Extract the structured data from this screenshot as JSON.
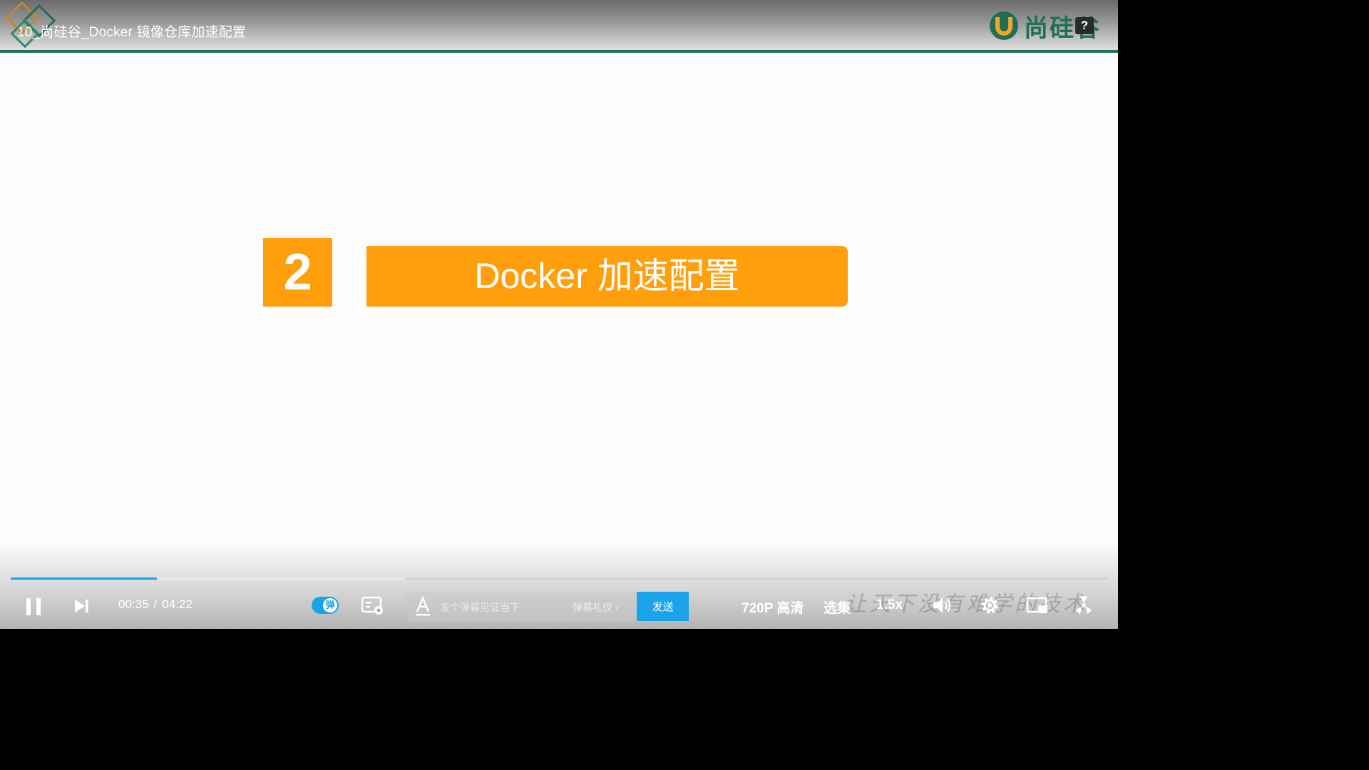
{
  "video": {
    "title": "10_尚硅谷_Docker 镜像仓库加速配置"
  },
  "brand": {
    "name": "尚硅谷",
    "help_label": "?",
    "icons": {
      "deco": "diamond-deco-icon",
      "logo": "brand-logo-icon"
    }
  },
  "slide": {
    "number": "2",
    "heading": "Docker 加速配置"
  },
  "playback": {
    "current_time": "00:35",
    "separator": "/",
    "duration": "04:22",
    "played_fraction": 0.133,
    "buffered_fraction": 0.36
  },
  "danmaku": {
    "toggle_label": "弹",
    "enabled": true,
    "input_placeholder": "发个弹幕见证当下",
    "etiquette_label": "弹幕礼仪 ›",
    "send_label": "发送"
  },
  "controls": {
    "quality_label": "720P 高清",
    "episodes_label": "选集",
    "speed_label": "1.5x",
    "icons": [
      "pause-icon",
      "next-icon",
      "danmaku-settings-icon",
      "font-style-icon",
      "volume-icon",
      "settings-gear-icon",
      "picture-in-picture-icon",
      "more-icon"
    ]
  },
  "watermark": {
    "text": "让天下没有难学的技术"
  },
  "colors": {
    "accent": "#1aa3e8",
    "brand_green": "#1f6f57",
    "slide_orange": "#ff9f0b"
  }
}
